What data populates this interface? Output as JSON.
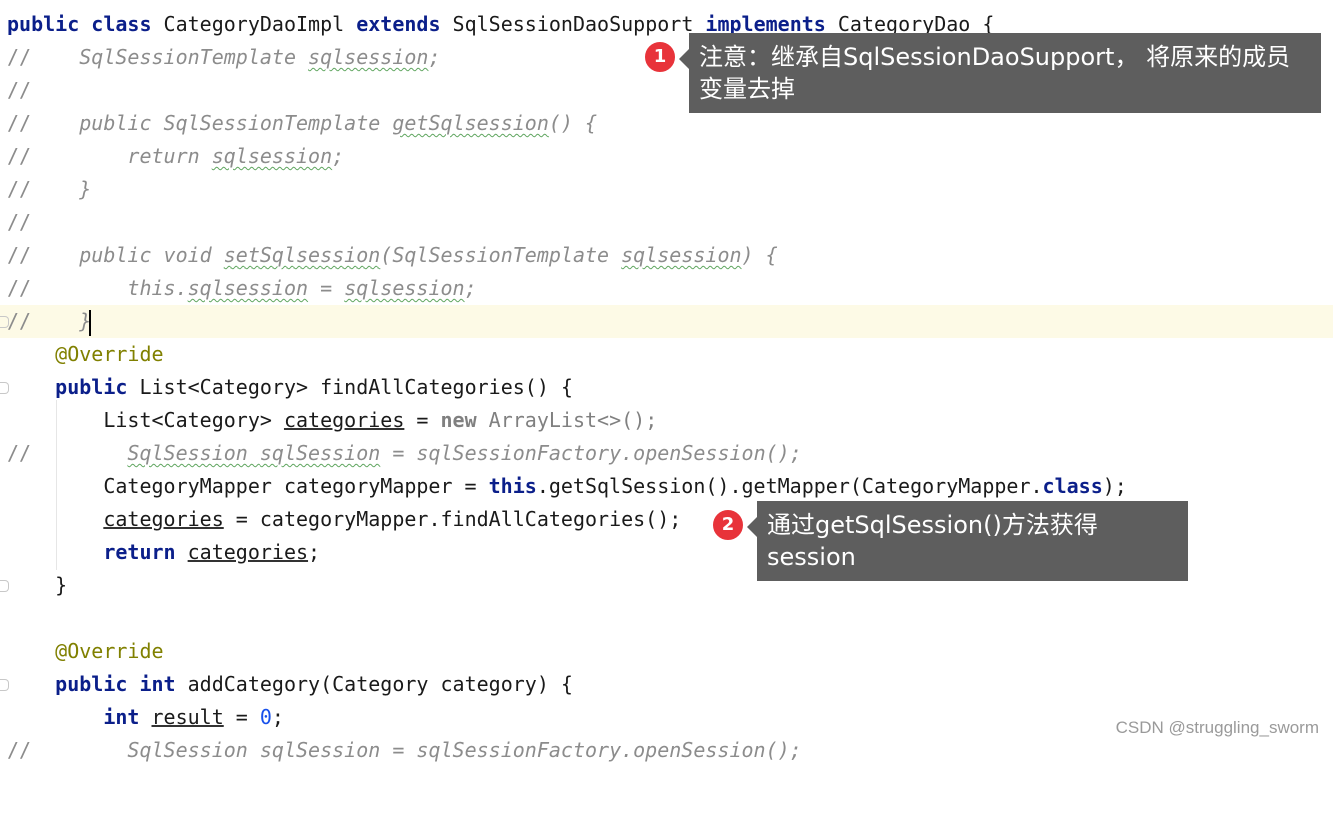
{
  "code": {
    "l1": [
      "public",
      " ",
      "class",
      " CategoryDaoImpl ",
      "extends",
      " SqlSessionDaoSupport ",
      "implements",
      " CategoryDao {"
    ],
    "l2": [
      "//",
      "    SqlSessionTemplate ",
      "sqlsession",
      ";"
    ],
    "l3": [
      "//"
    ],
    "l4": [
      "//",
      "    public SqlSessionTemplate ",
      "getSqlsession",
      "() {"
    ],
    "l5": [
      "//",
      "        return ",
      "sqlsession",
      ";"
    ],
    "l6": [
      "//",
      "    }"
    ],
    "l7": [
      "//"
    ],
    "l8": [
      "//",
      "    public void ",
      "setSqlsession",
      "(SqlSessionTemplate ",
      "sqlsession",
      ") {"
    ],
    "l9": [
      "//",
      "        this.",
      "sqlsession",
      " = ",
      "sqlsession",
      ";"
    ],
    "l10": [
      "//",
      "    }"
    ],
    "l11": [
      "    ",
      "@Override"
    ],
    "l12": [
      "    ",
      "public",
      " List<Category> findAllCategories() {"
    ],
    "l13": [
      "        List<Category> ",
      "categories",
      " = ",
      "new",
      " ",
      "ArrayList<>();"
    ],
    "l14": [
      "//",
      "        ",
      "SqlSession ",
      "sqlSession",
      " = sqlSessionFactory.openSession();"
    ],
    "l15": [
      "        CategoryMapper categoryMapper = ",
      "this",
      ".getSqlSession().getMapper(CategoryMapper.",
      "class",
      ");"
    ],
    "l16": [
      "        ",
      "categories",
      " = categoryMapper.findAllCategories();"
    ],
    "l17": [
      "        ",
      "return",
      " ",
      "categories",
      ";"
    ],
    "l18": [
      "    }"
    ],
    "l19": [
      ""
    ],
    "l20": [
      "    ",
      "@Override"
    ],
    "l21": [
      "    ",
      "public",
      " ",
      "int",
      " addCategory(Category category) {"
    ],
    "l22": [
      "        ",
      "int",
      " ",
      "result",
      " = ",
      "0",
      ";"
    ],
    "l23": [
      "//",
      "        SqlSession sqlSession = sqlSessionFactory.openSession();"
    ]
  },
  "callouts": [
    {
      "number": "1",
      "text": "注意：继承自SqlSessionDaoSupport， 将原来的成员变量去掉"
    },
    {
      "number": "2",
      "text": "通过getSqlSession()方法获得session"
    }
  ],
  "watermark": "CSDN @struggling_sworm",
  "colors": {
    "keyword": "#0b1f8a",
    "comment": "#8c8c8c",
    "annotation": "#808000",
    "callout_bg": "#5e5e5e",
    "badge": "#e8333a"
  }
}
